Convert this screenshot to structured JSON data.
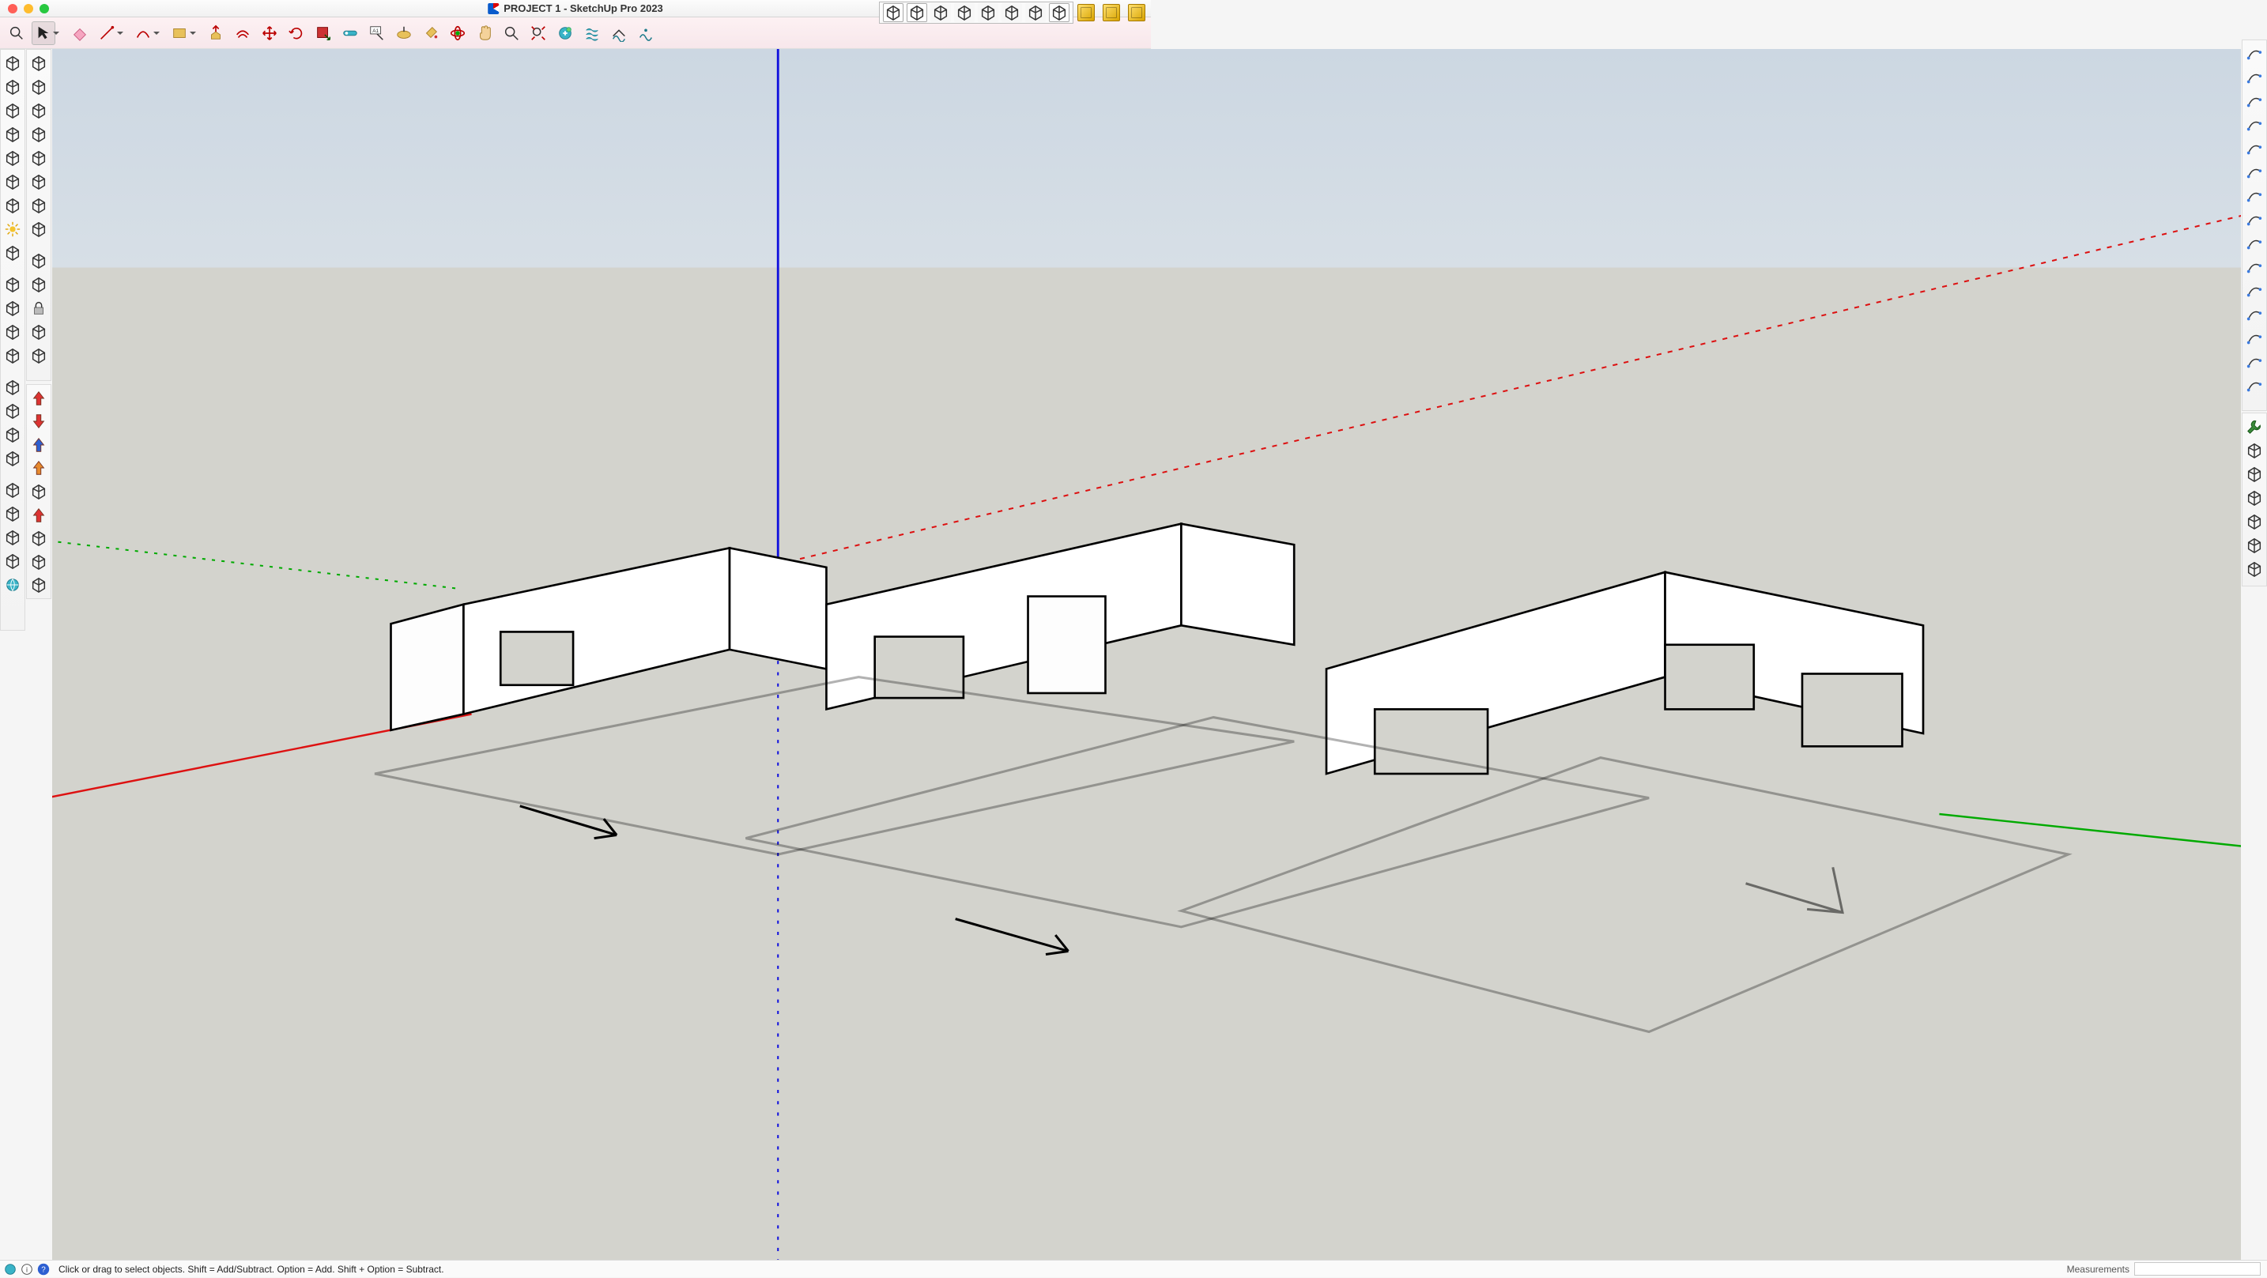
{
  "window": {
    "title": "PROJECT 1 - SketchUp Pro 2023"
  },
  "status": {
    "hint": "Click or drag to select objects. Shift = Add/Subtract. Option = Add. Shift + Option = Subtract.",
    "measure_label": "Measurements"
  },
  "top_toolbar": [
    {
      "name": "zoom-fit-icon",
      "dd": false
    },
    {
      "name": "select-tool",
      "dd": true,
      "selected": true
    },
    {
      "name": "eraser-tool",
      "dd": false
    },
    {
      "name": "line-tool",
      "dd": true
    },
    {
      "name": "arc-tool",
      "dd": true
    },
    {
      "name": "rectangle-tool",
      "dd": true
    },
    {
      "name": "push-pull-tool",
      "dd": false
    },
    {
      "name": "offset-tool",
      "dd": false
    },
    {
      "name": "move-tool",
      "dd": false
    },
    {
      "name": "rotate-tool",
      "dd": false
    },
    {
      "name": "scale-tool",
      "dd": false
    },
    {
      "name": "tape-measure-tool",
      "dd": false
    },
    {
      "name": "text-tool",
      "dd": false
    },
    {
      "name": "dimension-tool",
      "dd": false
    },
    {
      "name": "paint-bucket-tool",
      "dd": false
    },
    {
      "name": "orbit-tool",
      "dd": false
    },
    {
      "name": "pan-tool",
      "dd": false
    },
    {
      "name": "zoom-tool",
      "dd": false
    },
    {
      "name": "zoom-extents-tool",
      "dd": false
    },
    {
      "name": "add-location-tool",
      "dd": false
    },
    {
      "name": "sandbox-1",
      "dd": false
    },
    {
      "name": "sandbox-2",
      "dd": false
    },
    {
      "name": "sandbox-3",
      "dd": false
    }
  ],
  "float_right": [
    {
      "name": "solid-outer-shell",
      "active": true
    },
    {
      "name": "solid-intersect",
      "active": true
    },
    {
      "name": "solid-union",
      "active": false
    },
    {
      "name": "solid-subtract",
      "active": false
    },
    {
      "name": "solid-trim",
      "active": false
    },
    {
      "name": "solid-split",
      "active": false
    },
    {
      "name": "solid-5",
      "active": false
    },
    {
      "name": "solid-6",
      "active": true
    }
  ],
  "iso_views": [
    {
      "name": "iso-view-1"
    },
    {
      "name": "iso-view-2"
    },
    {
      "name": "iso-view-3"
    }
  ],
  "left_bar_1": [
    "warehouse-icon",
    "extension-icon",
    "camera-icon",
    "section-cut-icon",
    "circle-icon",
    "protractor-icon",
    "axes-icon",
    "sun-icon",
    "shadow-icon",
    "spacer",
    "group-icon",
    "component-icon",
    "dynamic-1",
    "dynamic-2",
    "spacer",
    "tags-icon",
    "layers-icon",
    "outliner-icon",
    "materials-icon",
    "spacer",
    "fog-icon",
    "styles-1",
    "styles-2",
    "styles-3",
    "globe-icon"
  ],
  "left_bar_2": [
    "sphere-icon",
    "teapot-icon",
    "torus-icon",
    "freeform-icon",
    "bool-1",
    "bool-2",
    "timer-icon",
    "bool-3",
    "spacer",
    "panel-icon",
    "panel2-icon",
    "lock-icon",
    "crosshair-icon",
    "snap-icon"
  ],
  "left_bar_3": [
    "arrow-up-red",
    "arrow-down-red",
    "arrow-up-blue",
    "arrow-up-orange",
    "grid-icon",
    "arrow-up-red-2",
    "cube-n",
    "cube-stack",
    "cube-f"
  ],
  "right_bar_1": [
    "curve-1",
    "curve-2",
    "curve-3",
    "curve-4",
    "curve-5",
    "curve-6",
    "curve-7",
    "curve-8",
    "curve-9",
    "curve-10",
    "curve-11",
    "curve-12",
    "curve-13",
    "curve-14",
    "curve-15"
  ],
  "right_bar_2": [
    "wrench-icon",
    "hull-icon",
    "shell-icon",
    "box-icon",
    "poly-icon",
    "poly2-icon",
    "poly3-icon"
  ]
}
